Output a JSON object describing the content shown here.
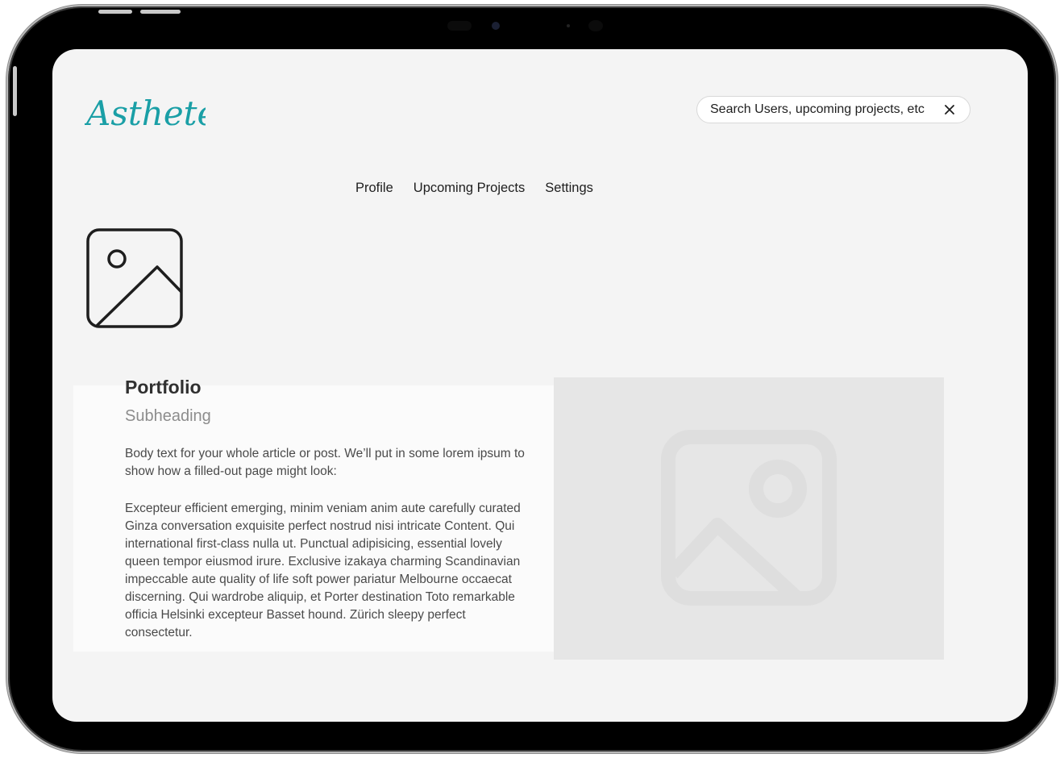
{
  "app": {
    "logo_text": "Asthete",
    "brand_color": "#1a9fa6"
  },
  "search": {
    "placeholder": "Search Users, upcoming projects, etc",
    "value": ""
  },
  "nav": {
    "profile": "Profile",
    "upcoming_projects": "Upcoming Projects",
    "settings": "Settings"
  },
  "article": {
    "title": "Portfolio",
    "subheading": "Subheading",
    "body_intro": "Body text for your whole article or post. We’ll put in some lorem ipsum to show how a filled-out page might look:",
    "body_main": "Excepteur efficient emerging, minim veniam anim aute carefully curated Ginza conversation exquisite perfect nostrud nisi intricate Content. Qui  international first-class nulla ut. Punctual adipisicing, essential lovely queen tempor eiusmod irure. Exclusive izakaya charming Scandinavian impeccable aute quality of life soft power pariatur Melbourne occaecat discerning. Qui wardrobe aliquip, et Porter destination Toto remarkable officia Helsinki excepteur Basset hound. Zürich sleepy perfect consectetur."
  },
  "icons": {
    "avatar": "image-placeholder-icon",
    "hero": "image-placeholder-icon",
    "clear": "close-icon"
  }
}
